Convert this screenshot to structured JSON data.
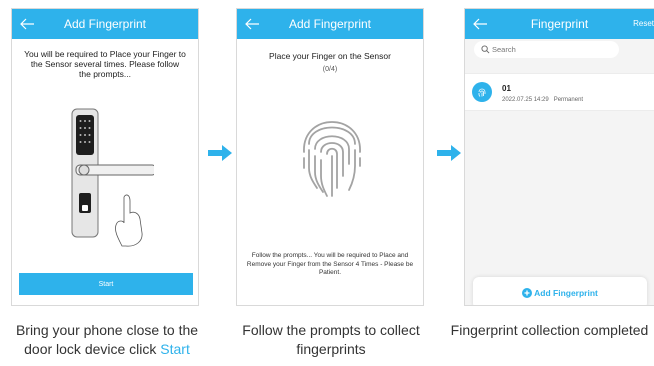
{
  "colors": {
    "accent": "#2eb2eb",
    "text": "#333333"
  },
  "screen1": {
    "title": "Add Fingerprint",
    "back_icon": "arrow-left-icon",
    "instruction": "You will be required to Place your Finger to the Sensor several times. Please follow the prompts...",
    "start_label": "Start"
  },
  "screen2": {
    "title": "Add Fingerprint",
    "back_icon": "arrow-left-icon",
    "heading": "Place your Finger on the Sensor",
    "progress": "(0/4)",
    "hint": "Follow the prompts... You will be required to Place and Remove your Finger from the Sensor 4 Times - Please be Patient."
  },
  "screen3": {
    "title": "Fingerprint",
    "back_icon": "arrow-left-icon",
    "reset_label": "Reset",
    "search_placeholder": "Search",
    "records": [
      {
        "name": "01",
        "date": "2022.07.25 14:29",
        "type": "Permanent"
      }
    ],
    "add_label": "Add Fingerprint"
  },
  "captions": {
    "step1_text": "Bring your phone close to the door lock device click ",
    "step1_highlight": "Start",
    "step2": "Follow the prompts to collect fingerprints",
    "step3": "Fingerprint collection completed"
  }
}
